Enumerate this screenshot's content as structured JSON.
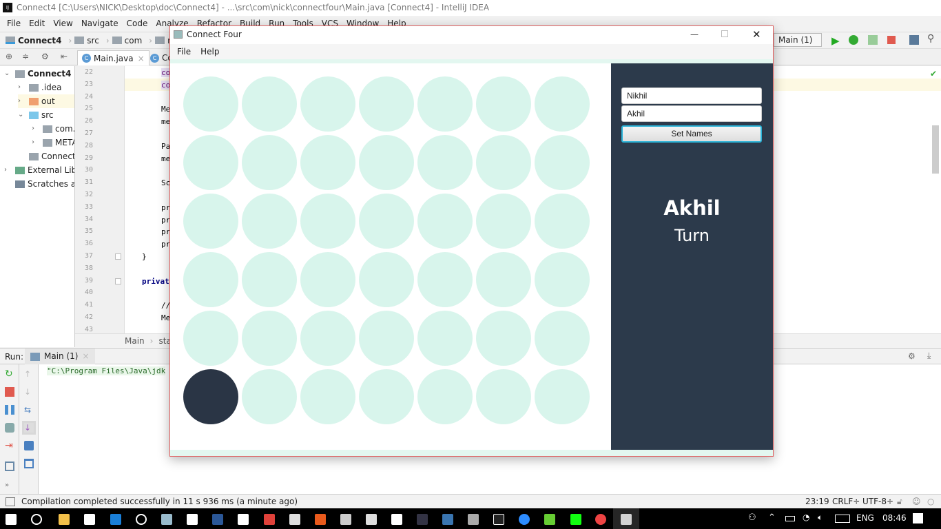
{
  "ide": {
    "title": "Connect4 [C:\\Users\\NICK\\Desktop\\doc\\Connect4] - ...\\src\\com\\nick\\connectfour\\Main.java [Connect4] - IntelliJ IDEA",
    "logo": "IJ",
    "menu": [
      "File",
      "Edit",
      "View",
      "Navigate",
      "Code",
      "Analyze",
      "Refactor",
      "Build",
      "Run",
      "Tools",
      "VCS",
      "Window",
      "Help"
    ],
    "breadcrumb": [
      "Connect4",
      "src",
      "com",
      "nick"
    ],
    "run_config": "Main (1)",
    "tabs": [
      {
        "label": "Main.java"
      },
      {
        "label": "Co"
      }
    ],
    "project_tree": [
      {
        "label": "Connect4",
        "suffix": "C:",
        "level": 0,
        "expanded": true,
        "color": "#9aa4ad"
      },
      {
        "label": ".idea",
        "level": 1,
        "expanded": false,
        "color": "#9aa4ad"
      },
      {
        "label": "out",
        "level": 1,
        "expanded": false,
        "color": "#f0a070"
      },
      {
        "label": "src",
        "level": 1,
        "expanded": true,
        "color": "#7cc7ea"
      },
      {
        "label": "com.",
        "level": 2,
        "expanded": false,
        "color": "#9aa4ad"
      },
      {
        "label": "META",
        "level": 2,
        "expanded": false,
        "color": "#9aa4ad"
      },
      {
        "label": "Connect4",
        "level": 1,
        "color": "#9aa4ad"
      },
      {
        "label": "External Libra",
        "level": 0,
        "expanded": false,
        "color": "#6a8"
      },
      {
        "label": "Scratches and",
        "level": 0,
        "color": "#789"
      }
    ],
    "code_lines": [
      {
        "n": "22",
        "text": "co"
      },
      {
        "n": "23",
        "text": "co"
      },
      {
        "n": "24",
        "text": ""
      },
      {
        "n": "25",
        "text": "Me"
      },
      {
        "n": "26",
        "text": "me"
      },
      {
        "n": "27",
        "text": ""
      },
      {
        "n": "28",
        "text": "Pa"
      },
      {
        "n": "29",
        "text": "me"
      },
      {
        "n": "30",
        "text": ""
      },
      {
        "n": "31",
        "text": "Sc"
      },
      {
        "n": "32",
        "text": ""
      },
      {
        "n": "33",
        "text": "pr"
      },
      {
        "n": "34",
        "text": "pr"
      },
      {
        "n": "35",
        "text": "pr"
      },
      {
        "n": "36",
        "text": "pr"
      },
      {
        "n": "37",
        "text": "}"
      },
      {
        "n": "38",
        "text": ""
      },
      {
        "n": "39",
        "text": "privat"
      },
      {
        "n": "40",
        "text": ""
      },
      {
        "n": "41",
        "text": "//"
      },
      {
        "n": "42",
        "text": "Me"
      },
      {
        "n": "43",
        "text": ""
      }
    ],
    "editor_breadcrumb": [
      "Main",
      "sta"
    ],
    "run": {
      "label": "Run:",
      "tab": "Main (1)",
      "console": "\"C:\\Program Files\\Java\\jdk"
    },
    "status": {
      "message": "Compilation completed successfully in 11 s 936 ms (a minute ago)",
      "position": "23:19",
      "line_sep": "CRLF÷",
      "encoding": "UTF-8÷"
    }
  },
  "taskbar": {
    "lang": "ENG",
    "time": "08:46"
  },
  "app": {
    "title": "Connect Four",
    "menu": [
      "File",
      "Help"
    ],
    "board": {
      "rows": 6,
      "cols": 7,
      "empty_color": "#d8f5ec",
      "player_color": "#2a3545",
      "discs": [
        {
          "row": 6,
          "col": 1,
          "player": "Akhil"
        }
      ]
    },
    "player1": "Nikhil",
    "player2": "Akhil",
    "set_names": "Set Names",
    "current_player": "Akhil",
    "turn_label": "Turn",
    "panel_color": "#2c3a4b"
  }
}
